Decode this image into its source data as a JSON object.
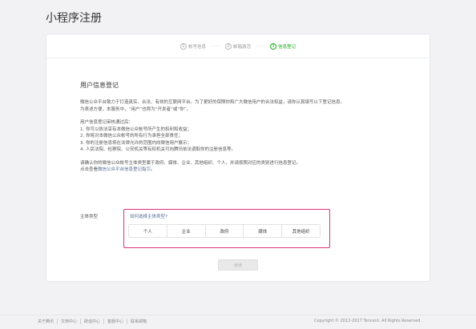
{
  "page": {
    "title": "小程序注册"
  },
  "steps": [
    {
      "num": "1",
      "label": "帐号信息",
      "active": false
    },
    {
      "num": "2",
      "label": "邮箱激活",
      "active": false
    },
    {
      "num": "3",
      "label": "信息登记",
      "active": true
    }
  ],
  "colors": {
    "accent": "#1aad19",
    "link": "#576b95",
    "highlight": "#e0307a"
  },
  "content": {
    "heading": "用户信息登记",
    "intro": [
      "微信公众平台致力于打造真实、合法、有效的互联网平台。为了更好的保障你和广大微信用户的合法权益，请你认真填写以下登记信息。",
      "为表述方便，本服务中，“用户”也称为“开发者”或“你”。"
    ],
    "rights_title": "用户信息登记审核通过后：",
    "rights": [
      "1. 你可以依法享有本微信公众帐号所产生的权利和收益；",
      "2. 你将对本微信公众帐号的所有行为承担全部责任；",
      "3. 你的注册信息将在法律允许的范围内向微信用户展示；",
      "4. 人民法院、检察院、公安机关等有权机关可向腾讯依法调取你的注册信息等。"
    ],
    "confirm": "请确认你的微信公众帐号主体类型属于政府、媒体、企业、其他组织、个人，并请按照对应的类别进行信息登记。",
    "guide_prefix": "点击查看",
    "guide_link": "微信公众平台信息登记指引",
    "guide_suffix": "。"
  },
  "subject_type": {
    "label": "主体类型",
    "question": "如何选择主体类型?",
    "options": [
      "个人",
      "企业",
      "政府",
      "媒体",
      "其他组织"
    ]
  },
  "actions": {
    "continue_label": "继续"
  },
  "footer": {
    "links": [
      "关于腾讯",
      "文档中心",
      "辟谣中心",
      "客服中心",
      "联系邮箱"
    ],
    "copyright": "Copyright © 2012-2017 Tencent. All Rights Reserved."
  }
}
